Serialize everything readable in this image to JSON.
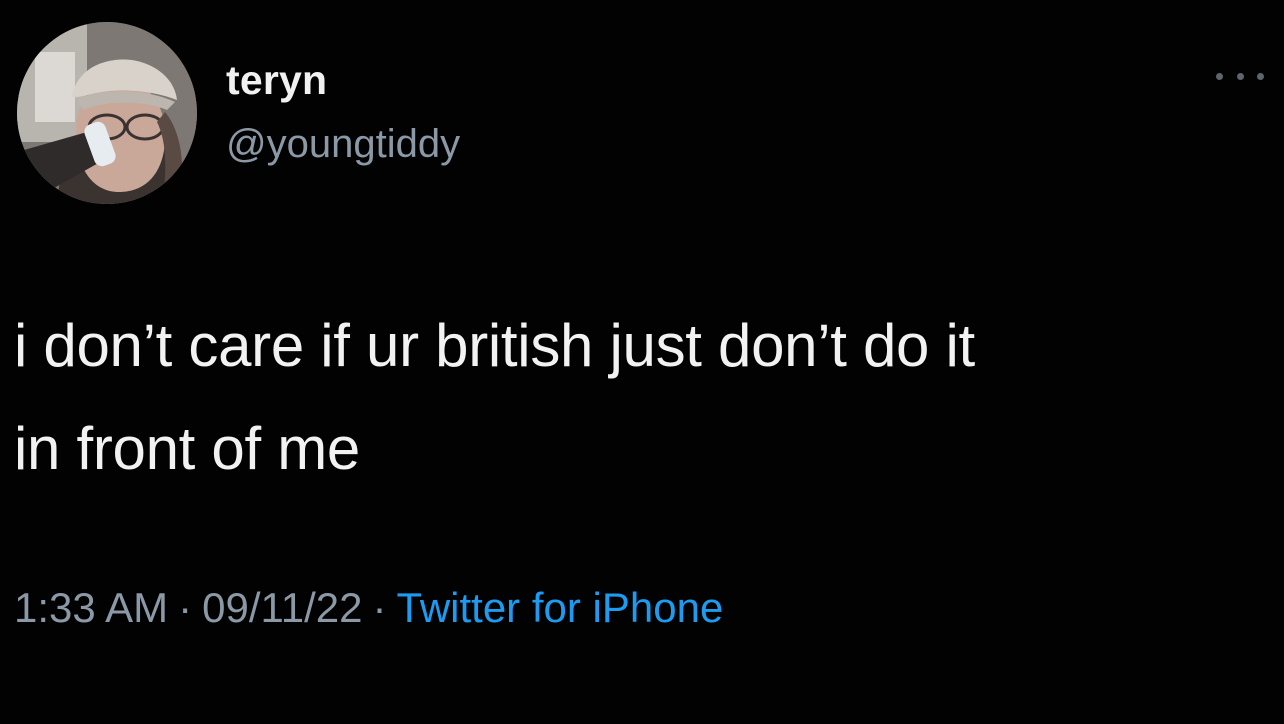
{
  "tweet": {
    "author": {
      "display_name": "teryn",
      "handle": "@youngtiddy",
      "avatar_icon": "profile-photo"
    },
    "more_icon": "more-options-icon",
    "text_lines": [
      "i don’t care if ur british just don’t do it",
      "in front of me"
    ],
    "time": "1:33 AM",
    "date": "09/11/22",
    "separator": "·",
    "source": "Twitter for iPhone",
    "colors": {
      "background": "#000000",
      "text": "#f2f2f2",
      "secondary": "#8b98a5",
      "link": "#1d9bf0"
    }
  }
}
